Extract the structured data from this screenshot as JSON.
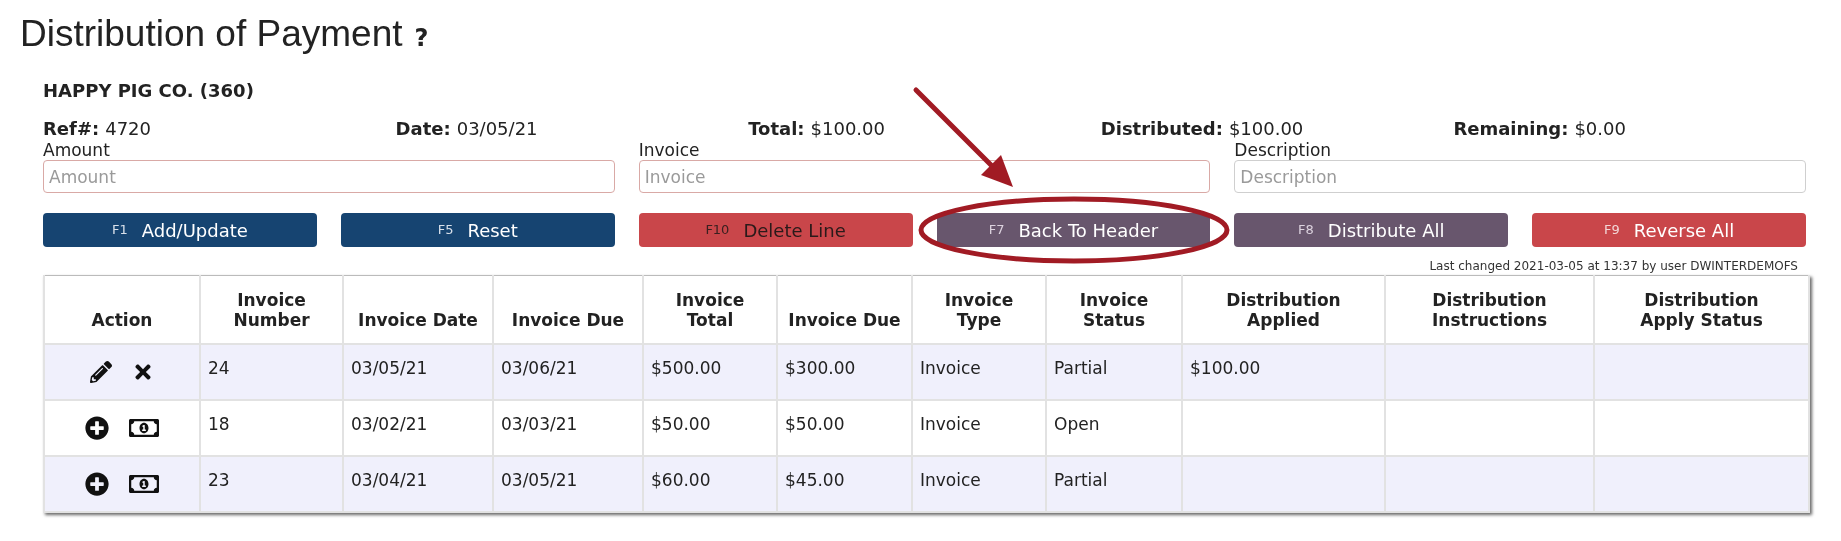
{
  "title": "Distribution of Payment",
  "help": "?",
  "customer": "HAPPY PIG CO. (360)",
  "summary": [
    {
      "label": "Ref#:",
      "value": "4720"
    },
    {
      "label": "Date:",
      "value": "03/05/21"
    },
    {
      "label": "Total:",
      "value": "$100.00"
    },
    {
      "label": "Distributed:",
      "value": "$100.00"
    },
    {
      "label": "Remaining:",
      "value": "$0.00"
    }
  ],
  "fields": [
    {
      "label": "Amount",
      "placeholder": "Amount",
      "required": true
    },
    {
      "label": "Invoice",
      "placeholder": "Invoice",
      "required": true
    },
    {
      "label": "Description",
      "placeholder": "Description",
      "required": false
    }
  ],
  "buttons": [
    {
      "key": "F1",
      "label": "Add/Update",
      "kind": "primary",
      "highlighted": false
    },
    {
      "key": "F5",
      "label": "Reset",
      "kind": "primary",
      "highlighted": false
    },
    {
      "key": "F10",
      "label": "Delete Line",
      "kind": "danger-muted",
      "highlighted": false
    },
    {
      "key": "F7",
      "label": "Back To Header",
      "kind": "secondary",
      "highlighted": true
    },
    {
      "key": "F8",
      "label": "Distribute All",
      "kind": "secondary",
      "highlighted": false
    },
    {
      "key": "F9",
      "label": "Reverse All",
      "kind": "danger",
      "highlighted": false
    }
  ],
  "last_changed": "Last changed 2021-03-05 at 13:37 by user DWINTERDEMOFS",
  "table": {
    "columns": [
      "Action",
      "Invoice Number",
      "Invoice Date",
      "Invoice Due",
      "Invoice Total",
      "Invoice Due",
      "Invoice Type",
      "Invoice Status",
      "Distribution Applied",
      "Distribution Instructions",
      "Distribution Apply Status"
    ],
    "rows": [
      {
        "actions": [
          {
            "kind": "edit"
          },
          {
            "kind": "delete"
          }
        ],
        "cells": [
          "",
          "24",
          "03/05/21",
          "03/06/21",
          "$500.00",
          "$300.00",
          "Invoice",
          "Partial",
          "$100.00",
          "",
          ""
        ]
      },
      {
        "actions": [
          {
            "kind": "add"
          },
          {
            "kind": "distribute"
          }
        ],
        "cells": [
          "",
          "18",
          "03/02/21",
          "03/03/21",
          "$50.00",
          "$50.00",
          "Invoice",
          "Open",
          "",
          "",
          ""
        ]
      },
      {
        "actions": [
          {
            "kind": "add"
          },
          {
            "kind": "distribute"
          }
        ],
        "cells": [
          "",
          "23",
          "03/04/21",
          "03/05/21",
          "$60.00",
          "$45.00",
          "Invoice",
          "Partial",
          "",
          "",
          ""
        ]
      }
    ]
  },
  "annotation": {
    "arrow": true
  }
}
